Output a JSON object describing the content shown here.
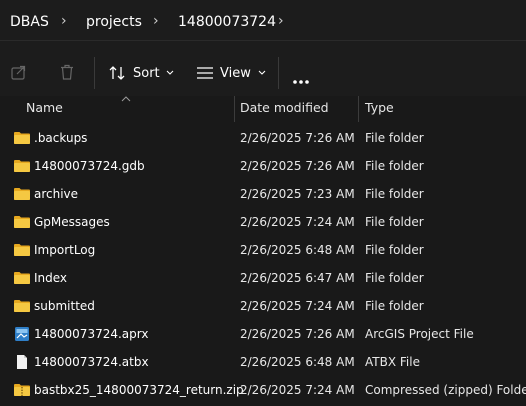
{
  "breadcrumb": [
    "DBAS",
    "projects",
    "14800073724"
  ],
  "toolbar": {
    "sort_label": "Sort",
    "view_label": "View"
  },
  "columns": {
    "name": "Name",
    "date": "Date modified",
    "type": "Type"
  },
  "files": [
    {
      "name": ".backups",
      "date": "2/26/2025 7:26 AM",
      "type": "File folder",
      "icon": "folder-icon"
    },
    {
      "name": "14800073724.gdb",
      "date": "2/26/2025 7:26 AM",
      "type": "File folder",
      "icon": "folder-icon"
    },
    {
      "name": "archive",
      "date": "2/26/2025 7:23 AM",
      "type": "File folder",
      "icon": "folder-icon"
    },
    {
      "name": "GpMessages",
      "date": "2/26/2025 7:24 AM",
      "type": "File folder",
      "icon": "folder-icon"
    },
    {
      "name": "ImportLog",
      "date": "2/26/2025 6:48 AM",
      "type": "File folder",
      "icon": "folder-icon"
    },
    {
      "name": "Index",
      "date": "2/26/2025 6:47 AM",
      "type": "File folder",
      "icon": "folder-icon"
    },
    {
      "name": "submitted",
      "date": "2/26/2025 7:24 AM",
      "type": "File folder",
      "icon": "folder-icon"
    },
    {
      "name": "14800073724.aprx",
      "date": "2/26/2025 7:26 AM",
      "type": "ArcGIS Project File",
      "icon": "arcgis-project-icon"
    },
    {
      "name": "14800073724.atbx",
      "date": "2/26/2025 6:48 AM",
      "type": "ATBX File",
      "icon": "document-icon"
    },
    {
      "name": "bastbx25_14800073724_return.zip",
      "date": "2/26/2025 7:24 AM",
      "type": "Compressed (zipped) Folder",
      "icon": "zip-folder-icon"
    }
  ],
  "colors": {
    "background": "#191919",
    "folder": "#f0c040",
    "accent": "#3c8fd6"
  }
}
